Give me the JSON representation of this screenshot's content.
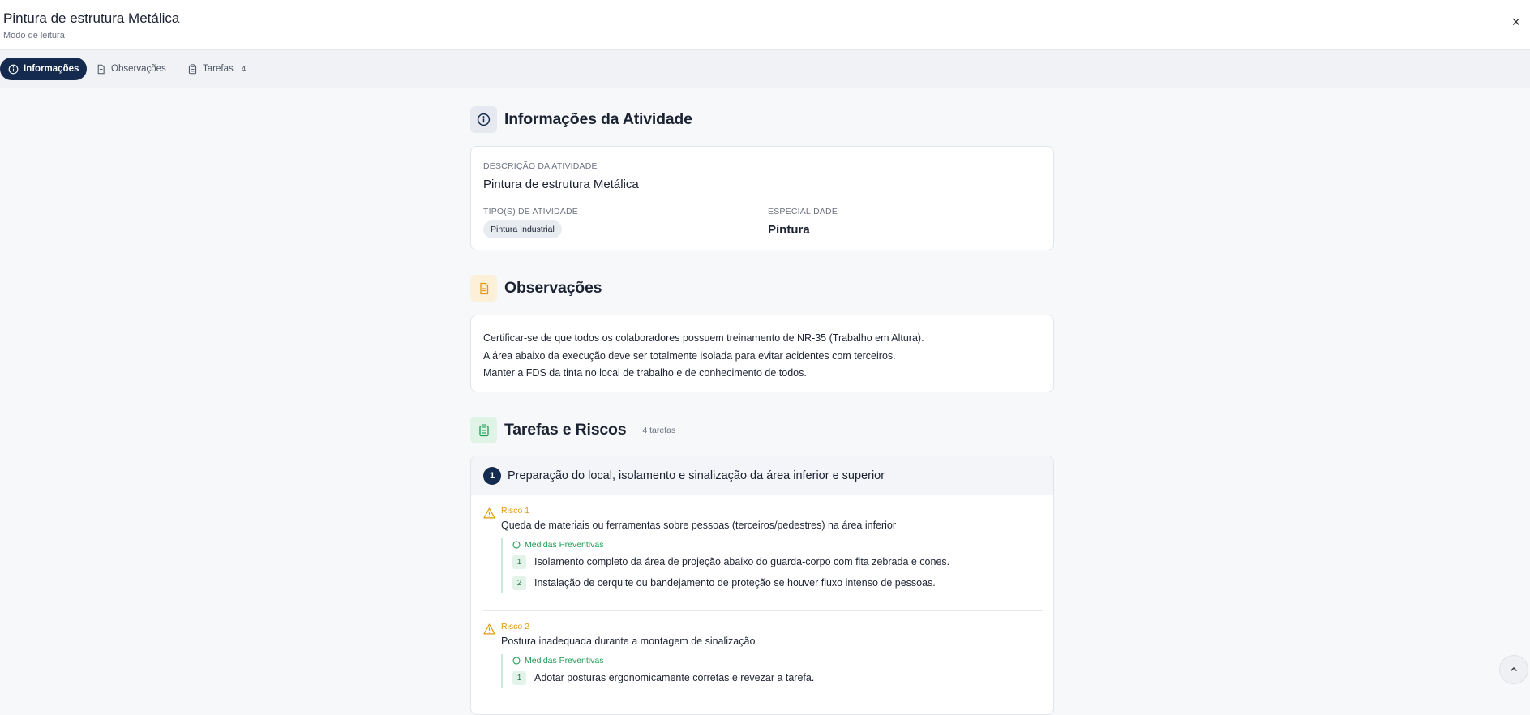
{
  "header": {
    "title": "Pintura de estrutura Metálica",
    "subtitle": "Modo de leitura",
    "close_label": "×"
  },
  "tabs": [
    {
      "label": "Informações",
      "active": true
    },
    {
      "label": "Observações",
      "active": false
    },
    {
      "label": "Tarefas",
      "count": "4",
      "active": false
    }
  ],
  "info": {
    "section_title": "Informações da Atividade",
    "description_label": "DESCRIÇÃO DA ATIVIDADE",
    "description_value": "Pintura de estrutura Metálica",
    "types_label": "TIPO(S) DE ATIVIDADE",
    "types": [
      "Pintura Industrial"
    ],
    "specialty_label": "ESPECIALIDADE",
    "specialty_value": "Pintura"
  },
  "observations": {
    "section_title": "Observações",
    "lines": [
      "Certificar-se de que todos os colaboradores possuem treinamento de NR-35 (Trabalho em Altura).",
      "A área abaixo da execução deve ser totalmente isolada para evitar acidentes com terceiros.",
      "Manter a FDS da tinta no local de trabalho e de conhecimento de todos."
    ]
  },
  "tasks": {
    "section_title": "Tarefas e Riscos",
    "count_label": "4 tarefas",
    "items": [
      {
        "number": "1",
        "title": "Preparação do local, isolamento e sinalização da área inferior e superior",
        "risks": [
          {
            "label": "Risco 1",
            "description": "Queda de materiais ou ferramentas sobre pessoas (terceiros/pedestres) na área inferior",
            "measures_title": "Medidas Preventivas",
            "measures": [
              {
                "number": "1",
                "text": "Isolamento completo da área de projeção abaixo do guarda-corpo com fita zebrada e cones."
              },
              {
                "number": "2",
                "text": "Instalação de cerquite ou bandejamento de proteção se houver fluxo intenso de pessoas."
              }
            ]
          },
          {
            "label": "Risco 2",
            "description": "Postura inadequada durante a montagem de sinalização",
            "measures_title": "Medidas Preventivas",
            "measures": [
              {
                "number": "1",
                "text": "Adotar posturas ergonomicamente corretas e revezar a tarefa."
              }
            ]
          }
        ]
      }
    ]
  },
  "colors": {
    "accent": "#142a4f",
    "warning": "#e09a0e",
    "success": "#1f9d55"
  }
}
